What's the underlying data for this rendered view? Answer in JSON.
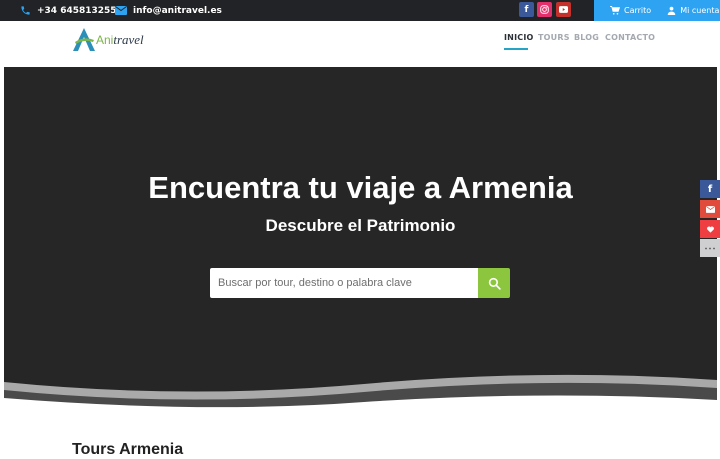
{
  "topbar": {
    "phone": "+34 645813255",
    "email": "info@anitravel.es",
    "social": {
      "facebook": "f",
      "instagram": "ig",
      "youtube": "yt"
    },
    "cart_label": "Carrito",
    "account_label": "Mi cuenta",
    "icons": {
      "phone": "phone-icon",
      "mail": "mail-icon",
      "cart": "cart-icon",
      "user": "user-icon"
    }
  },
  "header": {
    "logo_prefix": "Ani",
    "logo_script": "travel",
    "nav": [
      {
        "label": "INICIO",
        "active": true
      },
      {
        "label": "TOURS"
      },
      {
        "label": "BLOG"
      },
      {
        "label": "CONTACTO"
      }
    ]
  },
  "hero": {
    "title": "Encuentra tu viaje a Armenia",
    "subtitle": "Descubre el Patrimonio",
    "search_placeholder": "Buscar por tour, destino o palabra clave"
  },
  "share": {
    "icons": [
      "facebook-icon",
      "mail-icon",
      "heart-icon",
      "more-icon"
    ]
  },
  "below": {
    "title": "Tours Armenia"
  },
  "colors": {
    "topbar": "#222326",
    "accent_blue": "#2ea3f2",
    "search_green": "#8cc63f",
    "hero_bg": "#262626"
  }
}
